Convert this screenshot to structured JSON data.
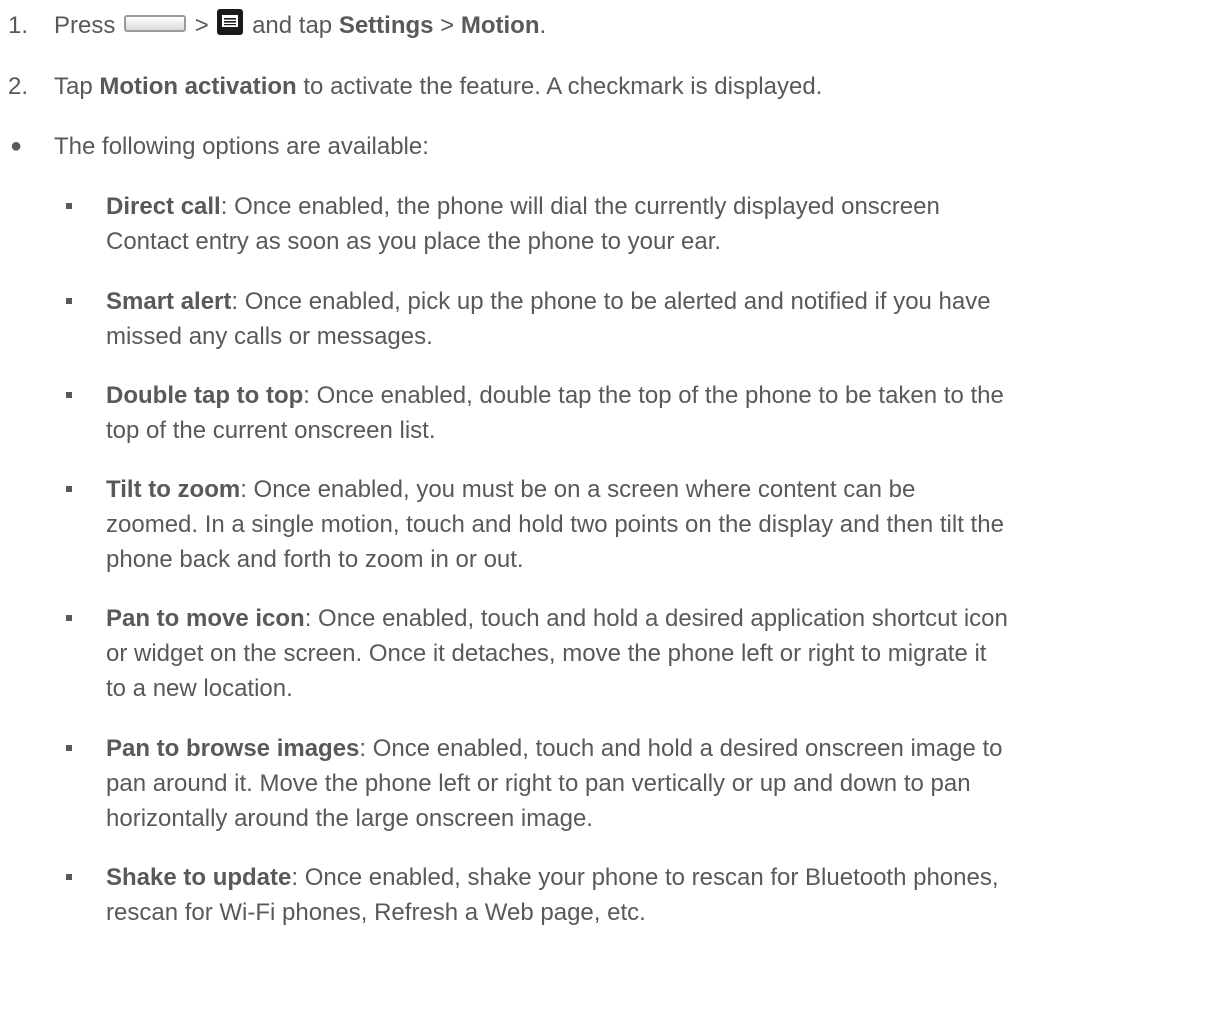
{
  "steps": [
    {
      "number": "1.",
      "pre": "Press",
      "gt1": ">",
      "mid": "and tap",
      "bold1": "Settings",
      "gt2": ">",
      "bold2": "Motion",
      "end": "."
    },
    {
      "number": "2.",
      "pre": "Tap",
      "bold": "Motion activation",
      "post": "to activate the feature. A checkmark is displayed."
    }
  ],
  "intro_bullet": "The following options are available:",
  "options": [
    {
      "term": "Direct call",
      "line1": ": Once enabled, the phone will dial the currently displayed onscreen",
      "lines": [
        "Contact entry as soon as you place the phone to your ear."
      ]
    },
    {
      "term": "Smart alert",
      "line1": ": Once enabled, pick up the phone to be alerted and notified if you have",
      "lines": [
        "missed any calls or messages."
      ]
    },
    {
      "term": "Double tap to top",
      "line1": ": Once enabled, double tap the top of the phone to be taken to the",
      "lines": [
        "top of the current onscreen list."
      ]
    },
    {
      "term": "Tilt to zoom",
      "line1": ": Once enabled, you must be on a screen where content can be",
      "lines": [
        "zoomed. In a single motion, touch and hold two points on the display and then tilt the",
        "phone back and forth to zoom in or out."
      ]
    },
    {
      "term": "Pan to move icon",
      "line1": ": Once enabled, touch and hold a desired application shortcut icon",
      "lines": [
        "or widget on the screen. Once it detaches, move the phone left or right to migrate it",
        "to a new location."
      ]
    },
    {
      "term": "Pan to browse images",
      "line1": ": Once enabled, touch and hold a desired onscreen image to",
      "lines": [
        "pan around it. Move the phone left or right to pan vertically or up and down to pan",
        "horizontally around the large onscreen image."
      ]
    },
    {
      "term": "Shake to update",
      "line1": ": Once enabled, shake your phone to rescan for Bluetooth phones,",
      "lines": [
        "rescan for Wi-Fi phones, Refresh a Web page, etc."
      ]
    }
  ],
  "icons": {
    "home_key": "home-key-icon",
    "menu_key": "menu-key-icon"
  }
}
